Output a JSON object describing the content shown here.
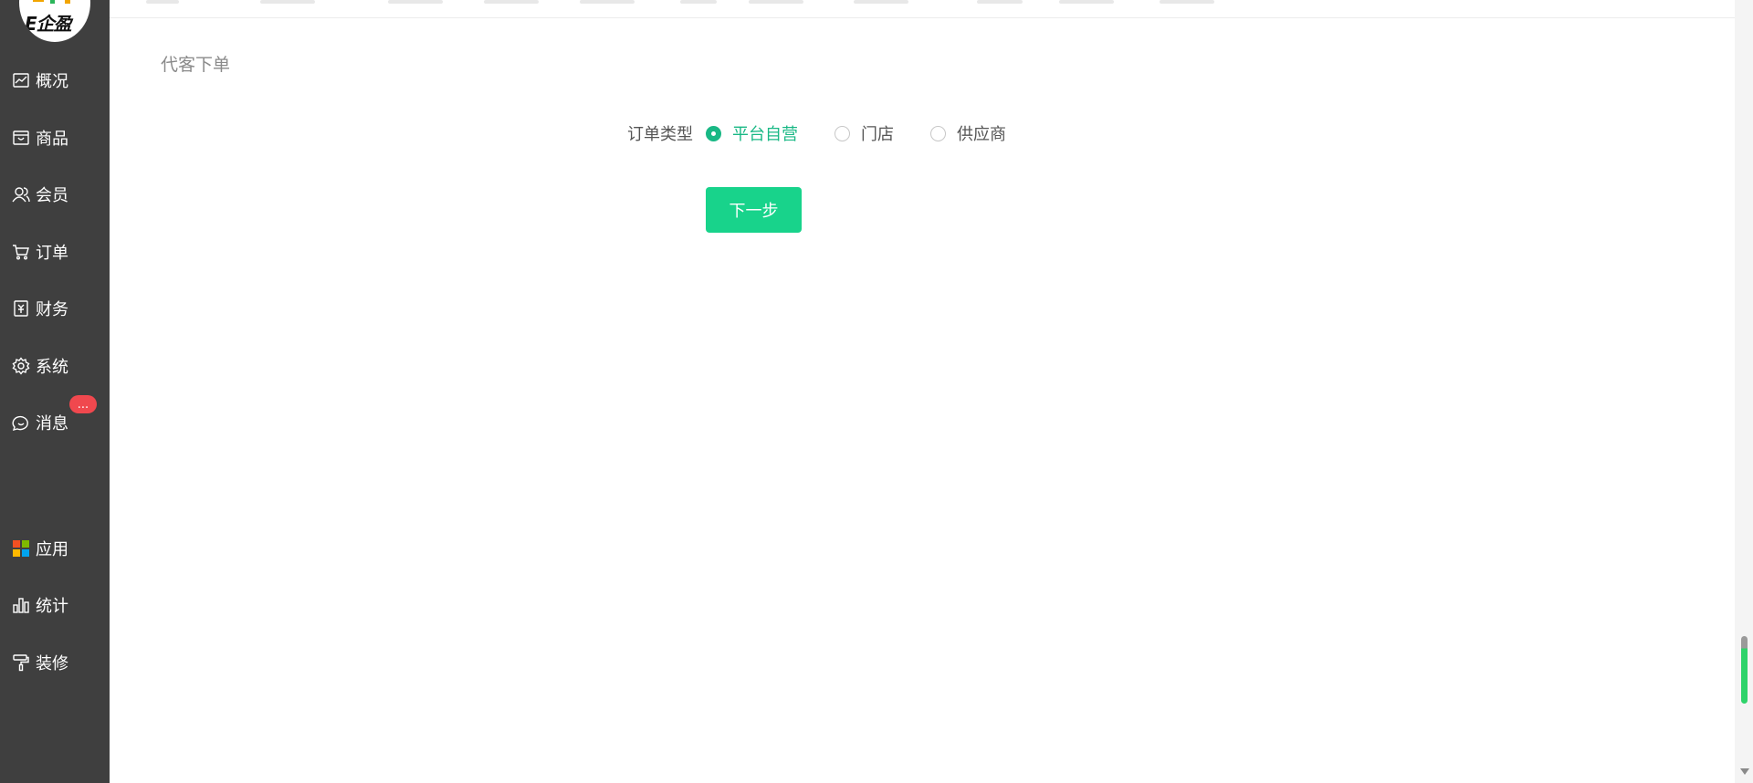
{
  "sidebar": {
    "logo_text": "E企盈",
    "items": [
      {
        "label": "概况",
        "icon": "chart-line-icon"
      },
      {
        "label": "商品",
        "icon": "shopping-bag-icon"
      },
      {
        "label": "会员",
        "icon": "users-icon"
      },
      {
        "label": "订单",
        "icon": "cart-icon"
      },
      {
        "label": "财务",
        "icon": "finance-icon"
      },
      {
        "label": "系统",
        "icon": "gear-icon"
      },
      {
        "label": "消息",
        "icon": "message-icon"
      },
      {
        "label": "应用",
        "icon": "apps-grid-icon"
      },
      {
        "label": "统计",
        "icon": "bar-chart-icon"
      },
      {
        "label": "装修",
        "icon": "paint-roller-icon"
      }
    ],
    "message_badge": "..."
  },
  "main": {
    "title": "代客下单",
    "order_type": {
      "label": "订单类型",
      "options": [
        {
          "label": "平台自营",
          "checked": true
        },
        {
          "label": "门店",
          "checked": false
        },
        {
          "label": "供应商",
          "checked": false
        }
      ]
    },
    "next_button": "下一步"
  },
  "colors": {
    "sidebar_bg": "#3f3f3f",
    "accent_green": "#18d38b",
    "radio_checked": "#19b885",
    "badge_red": "#f0484e"
  }
}
